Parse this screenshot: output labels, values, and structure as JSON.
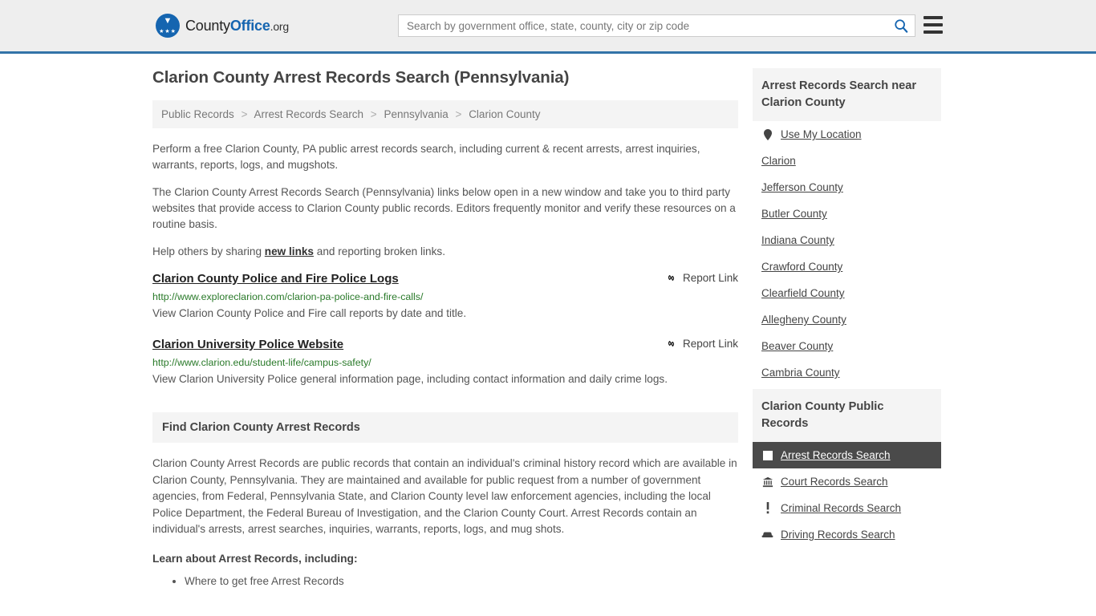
{
  "header": {
    "brand": {
      "part1": "County",
      "part2": "Office",
      "tld": ".org",
      "mark_icon": "eagle-emblem-icon"
    },
    "search": {
      "placeholder": "Search by government office, state, county, city or zip code",
      "value": "",
      "search_icon": "search-icon"
    },
    "menu_icon": "hamburger-menu-icon",
    "accent_color": "#1565b0",
    "border_color": "#3273a8"
  },
  "page": {
    "title": "Clarion County Arrest Records Search (Pennsylvania)",
    "breadcrumb": [
      "Public Records",
      "Arrest Records Search",
      "Pennsylvania",
      "Clarion County"
    ],
    "breadcrumb_separator": ">",
    "intro": [
      "Perform a free Clarion County, PA public arrest records search, including current & recent arrests, arrest inquiries, warrants, reports, logs, and mugshots.",
      "The Clarion County Arrest Records Search (Pennsylvania) links below open in a new window and take you to third party websites that provide access to Clarion County public records. Editors frequently monitor and verify these resources on a routine basis."
    ],
    "help_prefix": "Help others by sharing ",
    "help_link": "new links",
    "help_suffix": " and reporting broken links."
  },
  "links": [
    {
      "title": "Clarion County Police and Fire Police Logs",
      "url": "http://www.exploreclarion.com/clarion-pa-police-and-fire-calls/",
      "description": "View Clarion County Police and Fire call reports by date and title.",
      "report_label": "Report Link",
      "report_icon": "broken-link-icon"
    },
    {
      "title": "Clarion University Police Website",
      "url": "http://www.clarion.edu/student-life/campus-safety/",
      "description": "View Clarion University Police general information page, including contact information and daily crime logs.",
      "report_label": "Report Link",
      "report_icon": "broken-link-icon"
    }
  ],
  "find_section": {
    "heading": "Find Clarion County Arrest Records",
    "body": "Clarion County Arrest Records are public records that contain an individual's criminal history record which are available in Clarion County, Pennsylvania. They are maintained and available for public request from a number of government agencies, from Federal, Pennsylvania State, and Clarion County level law enforcement agencies, including the local Police Department, the Federal Bureau of Investigation, and the Clarion County Court. Arrest Records contain an individual's arrests, arrest searches, inquiries, warrants, reports, logs, and mug shots.",
    "learn_heading": "Learn about Arrest Records, including:",
    "learn_items": [
      "Where to get free Arrest Records"
    ]
  },
  "sidebar": {
    "near_heading": "Arrest Records Search near Clarion County",
    "near_items": [
      {
        "label": "Use My Location",
        "icon": "map-pin-icon"
      },
      {
        "label": "Clarion",
        "icon": ""
      },
      {
        "label": "Jefferson County",
        "icon": ""
      },
      {
        "label": "Butler County",
        "icon": ""
      },
      {
        "label": "Indiana County",
        "icon": ""
      },
      {
        "label": "Crawford County",
        "icon": ""
      },
      {
        "label": "Clearfield County",
        "icon": ""
      },
      {
        "label": "Allegheny County",
        "icon": ""
      },
      {
        "label": "Beaver County",
        "icon": ""
      },
      {
        "label": "Cambria County",
        "icon": ""
      }
    ],
    "records_heading": "Clarion County Public Records",
    "records_items": [
      {
        "label": "Arrest Records Search",
        "icon": "white-square-icon",
        "active": true
      },
      {
        "label": "Court Records Search",
        "icon": "courthouse-icon",
        "active": false
      },
      {
        "label": "Criminal Records Search",
        "icon": "exclamation-icon",
        "active": false
      },
      {
        "label": "Driving Records Search",
        "icon": "car-icon",
        "active": false
      }
    ],
    "active_bg": "#4a4a4a"
  }
}
